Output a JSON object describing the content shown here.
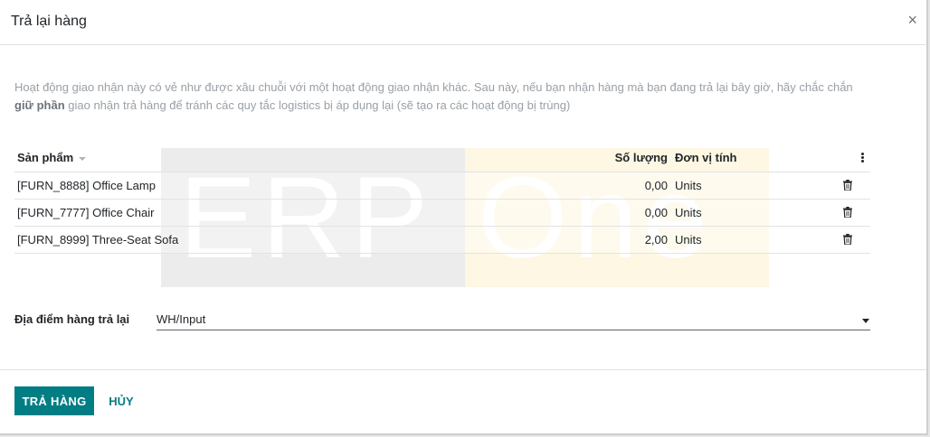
{
  "dialog": {
    "title": "Trả lại hàng",
    "close_glyph": "×"
  },
  "notice": {
    "part1": "Hoạt động giao nhận này có vẻ như được xâu chuỗi với một hoạt động giao nhận khác. Sau này, nếu bạn nhận hàng mà bạn đang trả lại bây giờ, hãy chắc chắn ",
    "bold": "giữ phần",
    "part2": " giao nhận trả hàng để tránh các quy tắc logistics bị áp dụng lại (sẽ tạo ra các hoạt động bị trùng)"
  },
  "watermark": {
    "left": "ERP",
    "right": "One"
  },
  "table": {
    "headers": {
      "product": "Sản phẩm",
      "quantity": "Số lượng",
      "uom": "Đơn vị tính"
    },
    "rows": [
      {
        "product": "[FURN_8888] Office Lamp",
        "quantity": "0,00",
        "uom": "Units"
      },
      {
        "product": "[FURN_7777] Office Chair",
        "quantity": "0,00",
        "uom": "Units"
      },
      {
        "product": "[FURN_8999] Three-Seat Sofa",
        "quantity": "2,00",
        "uom": "Units"
      }
    ]
  },
  "location": {
    "label": "Địa điểm hàng trả lại",
    "value": "WH/Input"
  },
  "footer": {
    "confirm_label": "TRẢ HÀNG",
    "cancel_label": "HỦY"
  },
  "colors": {
    "primary": "#017e84"
  },
  "icons": {
    "row_delete": "trash-icon",
    "column_options": "kebab-menu-icon",
    "sort": "sort-down-icon",
    "dropdown": "caret-down-icon"
  }
}
